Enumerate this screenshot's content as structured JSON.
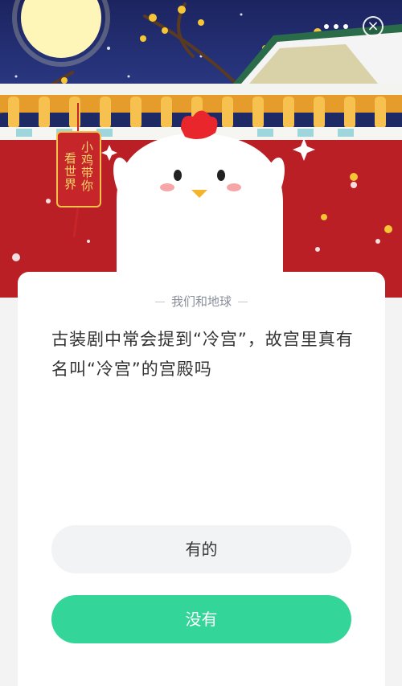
{
  "hero": {
    "tag_text_right": "小鸡带你",
    "tag_text_left": "看世界",
    "close_label": "×"
  },
  "card": {
    "source": "我们和地球",
    "question": "古装剧中常会提到“冷宫”，故宫里真有名叫“冷宫”的宫殿吗",
    "options": [
      {
        "label": "有的"
      },
      {
        "label": "没有"
      }
    ]
  },
  "colors": {
    "accent_green": "#34d598",
    "palace_red": "#c6252a",
    "night_sky": "#1e2a66"
  }
}
